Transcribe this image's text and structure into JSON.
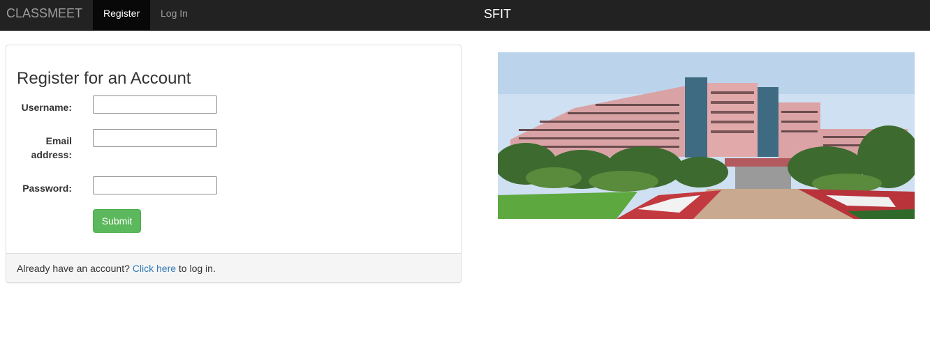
{
  "navbar": {
    "brand": "CLASSMEET",
    "items": [
      {
        "label": "Register",
        "active": true
      },
      {
        "label": "Log In",
        "active": false
      }
    ],
    "center_title": "SFIT",
    "bg_color": "#222222"
  },
  "form": {
    "title": "Register for an Account",
    "fields": [
      {
        "label": "Username:",
        "value": "",
        "placeholder": ""
      },
      {
        "label_lines": [
          "Email",
          "address:"
        ],
        "value": "",
        "placeholder": ""
      },
      {
        "label": "Password:",
        "value": "",
        "placeholder": ""
      }
    ],
    "submit_label": "Submit",
    "submit_color": "#5cb85c"
  },
  "footer": {
    "prefix": "Already have an account?",
    "link": "Click here",
    "suffix": "to log in.",
    "link_color": "#337ab7"
  },
  "campus_image": {
    "description_icon": "campus-building-photo"
  }
}
